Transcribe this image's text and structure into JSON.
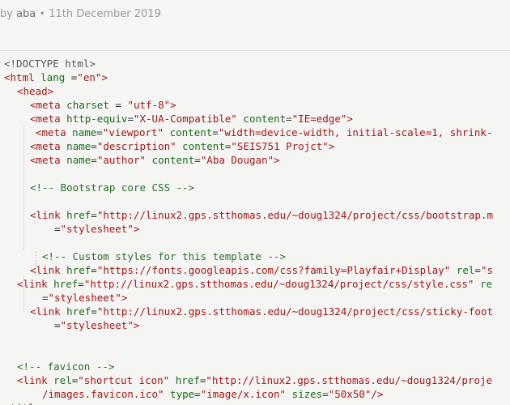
{
  "post_meta": {
    "by_prefix": "by ",
    "author": "aba",
    "separator": " • ",
    "date": "11th December 2019"
  },
  "code_lines": [
    {
      "tokens": [
        {
          "t": "doc",
          "v": "<!DOCTYPE html>"
        }
      ]
    },
    {
      "tokens": [
        {
          "t": "tag",
          "v": "<html"
        },
        {
          "t": "attr",
          "v": " lang"
        },
        {
          "t": "pun",
          "v": " ="
        },
        {
          "t": "str",
          "v": "\"en\""
        },
        {
          "t": "tag",
          "v": ">"
        }
      ]
    },
    {
      "tokens": [
        {
          "t": "tag",
          "v": "<head>"
        }
      ]
    },
    {
      "tokens": [
        {
          "t": "tag",
          "v": "<meta"
        },
        {
          "t": "attr",
          "v": " charset"
        },
        {
          "t": "pun",
          "v": " = "
        },
        {
          "t": "str",
          "v": "\"utf-8\""
        },
        {
          "t": "tag",
          "v": ">"
        }
      ]
    },
    {
      "tokens": [
        {
          "t": "tag",
          "v": "<meta"
        },
        {
          "t": "attr",
          "v": " http-equiv"
        },
        {
          "t": "pun",
          "v": "="
        },
        {
          "t": "str",
          "v": "\"X-UA-Compatible\""
        },
        {
          "t": "attr",
          "v": " content"
        },
        {
          "t": "pun",
          "v": "="
        },
        {
          "t": "str",
          "v": "\"IE=edge\""
        },
        {
          "t": "tag",
          "v": ">"
        }
      ]
    },
    {
      "tokens": [
        {
          "t": "tag",
          "v": "<meta"
        },
        {
          "t": "attr",
          "v": " name"
        },
        {
          "t": "pun",
          "v": "="
        },
        {
          "t": "str",
          "v": "\"viewport\""
        },
        {
          "t": "attr",
          "v": " content"
        },
        {
          "t": "pun",
          "v": "="
        },
        {
          "t": "str",
          "v": "\"width=device-width, initial-scale=1, shrink-"
        }
      ]
    },
    {
      "tokens": [
        {
          "t": "tag",
          "v": "<meta"
        },
        {
          "t": "attr",
          "v": " name"
        },
        {
          "t": "pun",
          "v": "="
        },
        {
          "t": "str",
          "v": "\"description\""
        },
        {
          "t": "attr",
          "v": " content"
        },
        {
          "t": "pun",
          "v": "="
        },
        {
          "t": "str",
          "v": "\"SEIS751 Projct\""
        },
        {
          "t": "tag",
          "v": ">"
        }
      ]
    },
    {
      "tokens": [
        {
          "t": "tag",
          "v": "<meta"
        },
        {
          "t": "attr",
          "v": " name"
        },
        {
          "t": "pun",
          "v": "="
        },
        {
          "t": "str",
          "v": "\"author\""
        },
        {
          "t": "attr",
          "v": " content"
        },
        {
          "t": "pun",
          "v": "="
        },
        {
          "t": "str",
          "v": "\"Aba Dougan\""
        },
        {
          "t": "tag",
          "v": ">"
        }
      ]
    },
    {
      "tokens": []
    },
    {
      "tokens": [
        {
          "t": "com",
          "v": "<!-- Bootstrap core CSS -->"
        }
      ]
    },
    {
      "tokens": []
    },
    {
      "tokens": [
        {
          "t": "tag",
          "v": "<link"
        },
        {
          "t": "attr",
          "v": " href"
        },
        {
          "t": "pun",
          "v": "="
        },
        {
          "t": "str",
          "v": "\"http://linux2.gps.stthomas.edu/~doug1324/project/css/bootstrap.m"
        }
      ]
    },
    {
      "tokens": [
        {
          "t": "pun",
          "v": "="
        },
        {
          "t": "str",
          "v": "\"stylesheet\""
        },
        {
          "t": "tag",
          "v": ">"
        }
      ]
    },
    {
      "tokens": []
    },
    {
      "tokens": [
        {
          "t": "com",
          "v": "<!-- Custom styles for this template -->"
        }
      ]
    },
    {
      "tokens": [
        {
          "t": "tag",
          "v": "<link"
        },
        {
          "t": "attr",
          "v": " href"
        },
        {
          "t": "pun",
          "v": "="
        },
        {
          "t": "str",
          "v": "\"https://fonts.googleapis.com/css?family=Playfair+Display\""
        },
        {
          "t": "attr",
          "v": " rel"
        },
        {
          "t": "pun",
          "v": "="
        },
        {
          "t": "str",
          "v": "\"s"
        }
      ]
    },
    {
      "tokens": [
        {
          "t": "tag",
          "v": "<link"
        },
        {
          "t": "attr",
          "v": " href"
        },
        {
          "t": "pun",
          "v": "="
        },
        {
          "t": "str",
          "v": "\"http://linux2.gps.stthomas.edu/~doug1324/project/css/style.css\""
        },
        {
          "t": "attr",
          "v": " re"
        }
      ]
    },
    {
      "tokens": [
        {
          "t": "pun",
          "v": "="
        },
        {
          "t": "str",
          "v": "\"stylesheet\""
        },
        {
          "t": "tag",
          "v": ">"
        }
      ]
    },
    {
      "tokens": [
        {
          "t": "tag",
          "v": "<link"
        },
        {
          "t": "attr",
          "v": " href"
        },
        {
          "t": "pun",
          "v": "="
        },
        {
          "t": "str",
          "v": "\"http://linux2.gps.stthomas.edu/~doug1324/project/css/sticky-foot"
        }
      ]
    },
    {
      "tokens": [
        {
          "t": "pun",
          "v": "="
        },
        {
          "t": "str",
          "v": "\"stylesheet\""
        },
        {
          "t": "tag",
          "v": ">"
        }
      ]
    },
    {
      "tokens": []
    },
    {
      "tokens": []
    },
    {
      "tokens": [
        {
          "t": "com",
          "v": "<!-- favicon -->"
        }
      ]
    },
    {
      "tokens": [
        {
          "t": "tag",
          "v": "<link"
        },
        {
          "t": "attr",
          "v": " rel"
        },
        {
          "t": "pun",
          "v": "="
        },
        {
          "t": "str",
          "v": "\"shortcut icon\""
        },
        {
          "t": "attr",
          "v": " href"
        },
        {
          "t": "pun",
          "v": "="
        },
        {
          "t": "str",
          "v": "\"http://linux2.gps.stthomas.edu/~doug1324/proje"
        }
      ]
    },
    {
      "tokens": [
        {
          "t": "str",
          "v": "/images.favicon.ico\""
        },
        {
          "t": "attr",
          "v": " type"
        },
        {
          "t": "pun",
          "v": "="
        },
        {
          "t": "str",
          "v": "\"image/x.icon\""
        },
        {
          "t": "attr",
          "v": " sizes"
        },
        {
          "t": "pun",
          "v": "="
        },
        {
          "t": "str",
          "v": "\"50x50\""
        },
        {
          "t": "tag",
          "v": "/>"
        }
      ]
    },
    {
      "tokens": [
        {
          "t": "tag",
          "v": "<titl"
        }
      ]
    }
  ],
  "colors": {
    "tag": "#a11717",
    "attr": "#1a6b1a",
    "string": "#a11717",
    "comment": "#2a6f2a",
    "background": "#f5f5f4"
  }
}
